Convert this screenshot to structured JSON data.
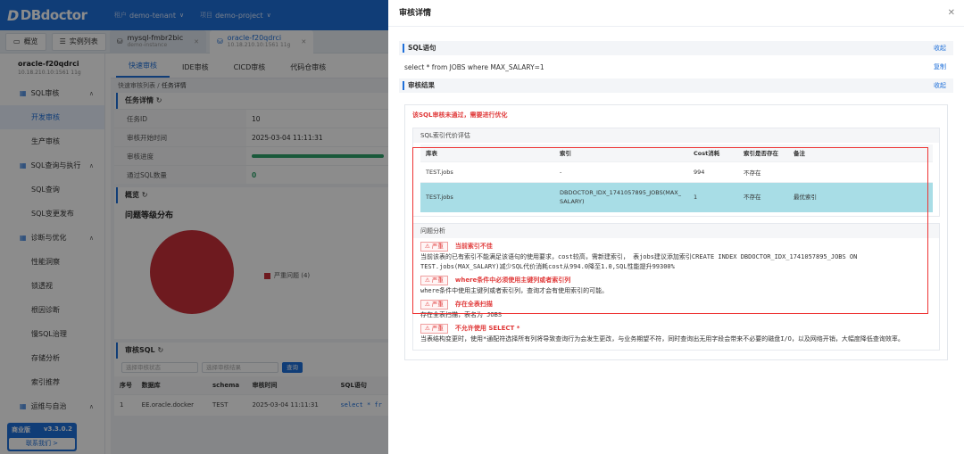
{
  "topbar": {
    "logo": "DBdoctor",
    "tenant_label": "租户",
    "tenant": "demo-tenant",
    "project_label": "项目",
    "project": "demo-project"
  },
  "tabs": {
    "overview": "概览",
    "instances": "实例列表",
    "inst_tabs": [
      {
        "name": "mysql-fmbr2bic",
        "sub": "demo-instance"
      },
      {
        "name": "oracle-f20qdrci",
        "sub": "10.18.210.10:1561 11g"
      }
    ]
  },
  "sidebar": {
    "instance_name": "oracle-f20qdrci",
    "instance_ip": "10.18.210.10:1561 11g",
    "items": [
      {
        "label": "SQL审核",
        "type": "sec"
      },
      {
        "label": "开发审核",
        "type": "sub",
        "active": true
      },
      {
        "label": "生产审核",
        "type": "sub"
      },
      {
        "label": "SQL查询与执行",
        "type": "sec"
      },
      {
        "label": "SQL查询",
        "type": "sub"
      },
      {
        "label": "SQL变更发布",
        "type": "sub"
      },
      {
        "label": "诊断与优化",
        "type": "sec"
      },
      {
        "label": "性能洞察",
        "type": "sub"
      },
      {
        "label": "锁透视",
        "type": "sub"
      },
      {
        "label": "根因诊断",
        "type": "sub"
      },
      {
        "label": "慢SQL治理",
        "type": "sub"
      },
      {
        "label": "存储分析",
        "type": "sub"
      },
      {
        "label": "索引推荐",
        "type": "sub"
      },
      {
        "label": "运维与自治",
        "type": "sec"
      }
    ],
    "edition": "商业版",
    "version": "v3.3.0.2",
    "contact": "联系我们 >"
  },
  "main": {
    "tabs": [
      "快速审核",
      "IDE审核",
      "CICD审核",
      "代码仓审核"
    ],
    "breadcrumb_parent": "快速审核列表",
    "breadcrumb_current": "任务详情",
    "task_title": "任务详情",
    "task_rows": [
      {
        "k": "任务ID",
        "v": "10"
      },
      {
        "k": "审核开始时间",
        "v": "2025-03-04 11:11:31"
      },
      {
        "k": "审核进度",
        "v": ""
      },
      {
        "k": "通过SQL数量",
        "v": "0"
      }
    ],
    "progress": 1.0,
    "overview_title": "概览",
    "chart_title": "问题等级分布",
    "legend": "严重问题 (4)",
    "audit_title": "审核SQL",
    "filter1": "选择审核状态",
    "filter2": "选择审核结果",
    "query": "查询",
    "cols": [
      "序号",
      "数据库",
      "schema",
      "审核时间",
      "SQL语句"
    ],
    "rows": [
      {
        "no": "1",
        "db": "EE.oracle.docker",
        "schema": "TEST",
        "time": "2025-03-04 11:11:31",
        "sql": "select * fr"
      }
    ]
  },
  "chart_data": {
    "type": "pie",
    "title": "问题等级分布",
    "categories": [
      "严重问题"
    ],
    "values": [
      4
    ],
    "colors": [
      "#c8303a"
    ],
    "legend": "right"
  },
  "drawer": {
    "title": "审核详情",
    "sql_section": "SQL语句",
    "collapse": "收起",
    "sql": "select * from JOBS where MAX_SALARY=1",
    "copy": "复制",
    "result_section": "审核结果",
    "fail_msg": "该SQL审核未通过，需要进行优化",
    "index_eval_title": "SQL索引代价评估",
    "eval_cols": [
      "库表",
      "索引",
      "Cost消耗",
      "索引是否存在",
      "备注"
    ],
    "eval_rows": [
      {
        "table": "TEST.jobs",
        "index": "-",
        "cost": "994",
        "exists": "不存在",
        "note": ""
      },
      {
        "table": "TEST.jobs",
        "index": "DBDOCTOR_IDX_1741057895_JOBS(MAX_SALARY)",
        "cost": "1",
        "exists": "不存在",
        "note": "最优索引"
      }
    ],
    "issue_title": "问题分析",
    "severity": "严重",
    "issues": [
      {
        "title": "当前索引不佳",
        "desc": "当前该表的已有索引不能满足该语句的使用要求，cost较高，需新建索引， 表jobs建议添加索引CREATE INDEX DBDOCTOR_IDX_1741057895_JOBS ON TEST.jobs(MAX_SALARY)减少SQL代价消耗cost从994.0降至1.0,SQL性能提升99300%"
      },
      {
        "title": "where条件中必须使用主键列或者索引列",
        "desc": "where条件中使用主键列或者索引列，查询才会有使用索引的可能。"
      },
      {
        "title": "存在全表扫描",
        "desc": "存在全表扫描，表名为 JOBS"
      },
      {
        "title": "不允许使用 SELECT *",
        "desc": "当表结构变更时，使用*通配符选择所有列将导致查询行为会发生更改，与业务期望不符，同时查询出无用字段会带来不必要的磁盘I/O，以及网络开销，大幅度降低查询效率。"
      }
    ]
  }
}
